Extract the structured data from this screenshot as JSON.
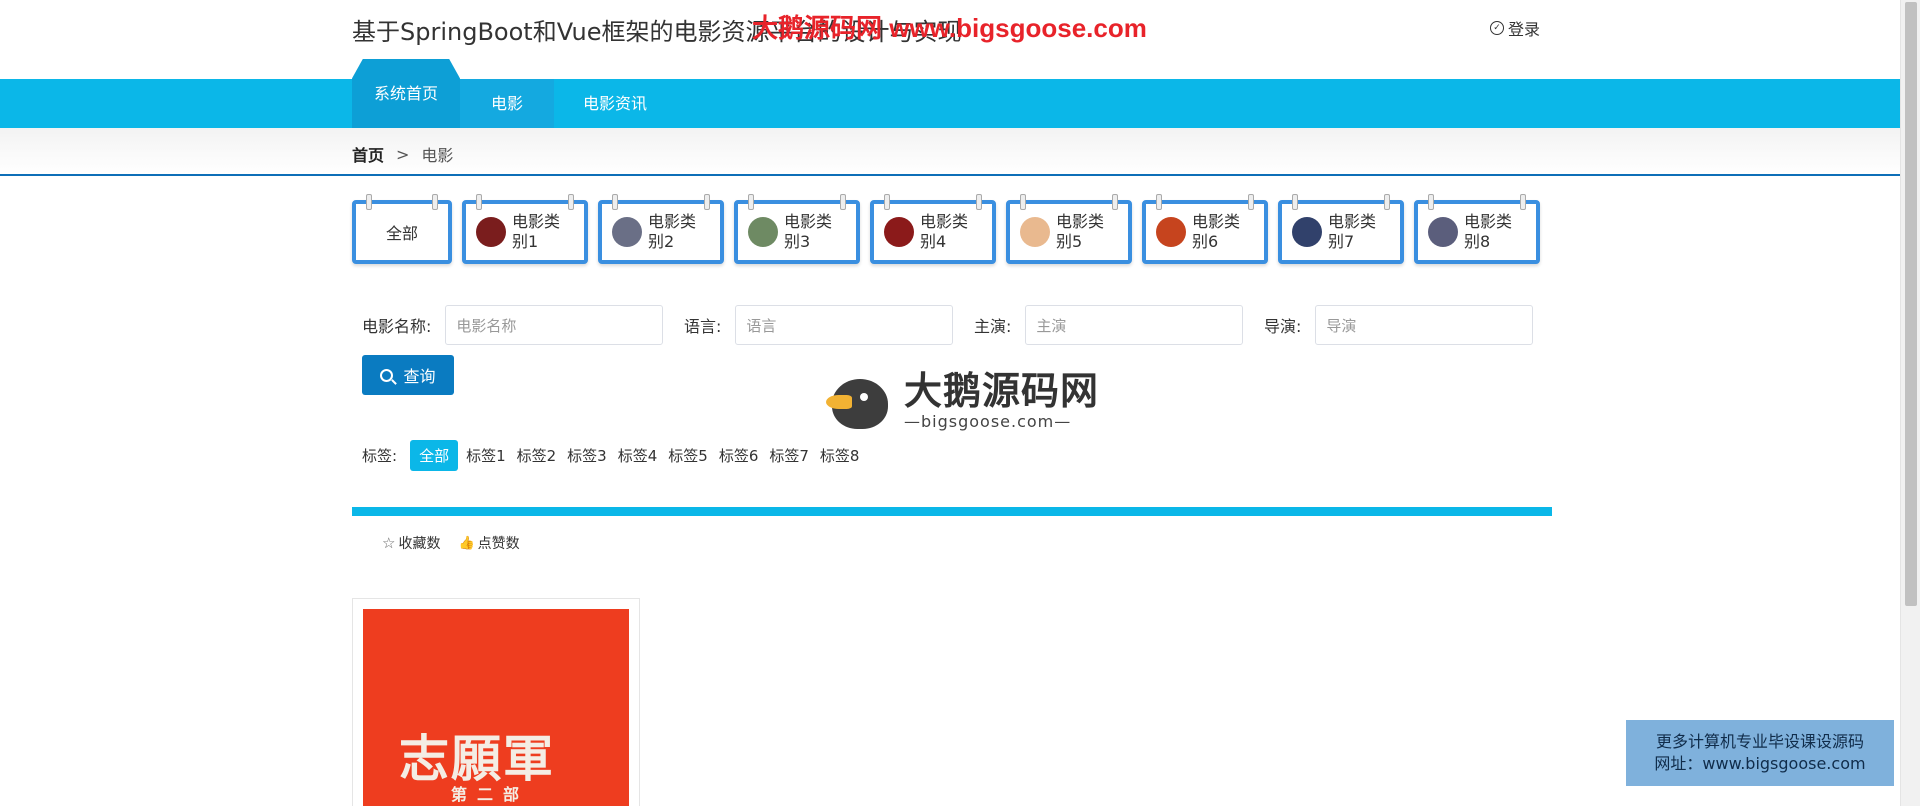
{
  "header": {
    "site_title": "基于SpringBoot和Vue框架的电影资源平台的设计与实现",
    "watermark": "大鹅源码网 www.bigsgoose.com",
    "login_label": "登录"
  },
  "nav": {
    "items": [
      {
        "label": "系统首页"
      },
      {
        "label": "电影"
      },
      {
        "label": "电影资讯"
      }
    ]
  },
  "breadcrumb": {
    "home": "首页",
    "separator": ">",
    "current": "电影"
  },
  "categories": {
    "all_label": "全部",
    "items": [
      {
        "label": "电影类别1",
        "thumb_color": "#7a1d1d"
      },
      {
        "label": "电影类别2",
        "thumb_color": "#6a6f86"
      },
      {
        "label": "电影类别3",
        "thumb_color": "#6e8a63"
      },
      {
        "label": "电影类别4",
        "thumb_color": "#8b1a1a"
      },
      {
        "label": "电影类别5",
        "thumb_color": "#e9b98f"
      },
      {
        "label": "电影类别6",
        "thumb_color": "#c6441e"
      },
      {
        "label": "电影类别7",
        "thumb_color": "#31416b"
      },
      {
        "label": "电影类别8",
        "thumb_color": "#5b5e7c"
      }
    ]
  },
  "search": {
    "name_label": "电影名称:",
    "name_placeholder": "电影名称",
    "language_label": "语言:",
    "language_placeholder": "语言",
    "actor_label": "主演:",
    "actor_placeholder": "主演",
    "director_label": "导演:",
    "director_placeholder": "导演",
    "button_label": "查询"
  },
  "watermark_logo": {
    "main": "大鹅源码网",
    "sub": "—bigsgoose.com—"
  },
  "tags": {
    "label": "标签:",
    "items": [
      "全部",
      "标签1",
      "标签2",
      "标签3",
      "标签4",
      "标签5",
      "标签6",
      "标签7",
      "标签8"
    ],
    "active_index": 0
  },
  "sort": {
    "favorites_label": "收藏数",
    "likes_label": "点赞数"
  },
  "movies": [
    {
      "poster_title": "志願軍",
      "poster_subtitle": "第二部"
    }
  ],
  "promo": {
    "line1": "更多计算机专业毕设课设源码",
    "line2": "网址：www.bigsgoose.com"
  },
  "colors": {
    "nav_blue": "#0bb7e8",
    "primary_button": "#0a7bc1",
    "category_border": "#3a8fe0"
  }
}
